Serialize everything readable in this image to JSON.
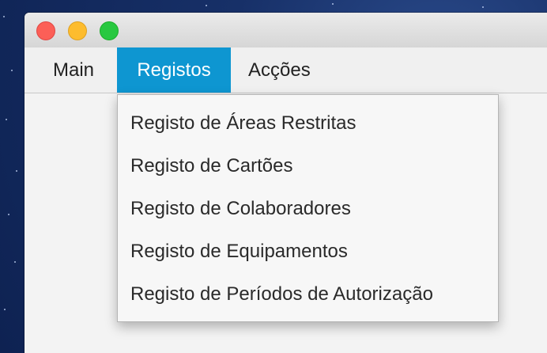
{
  "desktop": {
    "background_color": "#173068"
  },
  "window": {
    "controls": {
      "close_icon": "close-icon",
      "minimize_icon": "minimize-icon",
      "maximize_icon": "maximize-icon"
    }
  },
  "menubar": {
    "items": [
      {
        "label": "Main"
      },
      {
        "label": "Registos",
        "active": true
      },
      {
        "label": "Acções"
      }
    ],
    "accent_color": "#0e96d1"
  },
  "dropdown": {
    "items": [
      {
        "label": "Registo de Áreas Restritas"
      },
      {
        "label": "Registo de Cartões"
      },
      {
        "label": "Registo de Colaboradores"
      },
      {
        "label": "Registo de Equipamentos"
      },
      {
        "label": "Registo de Períodos de Autorização"
      }
    ]
  }
}
